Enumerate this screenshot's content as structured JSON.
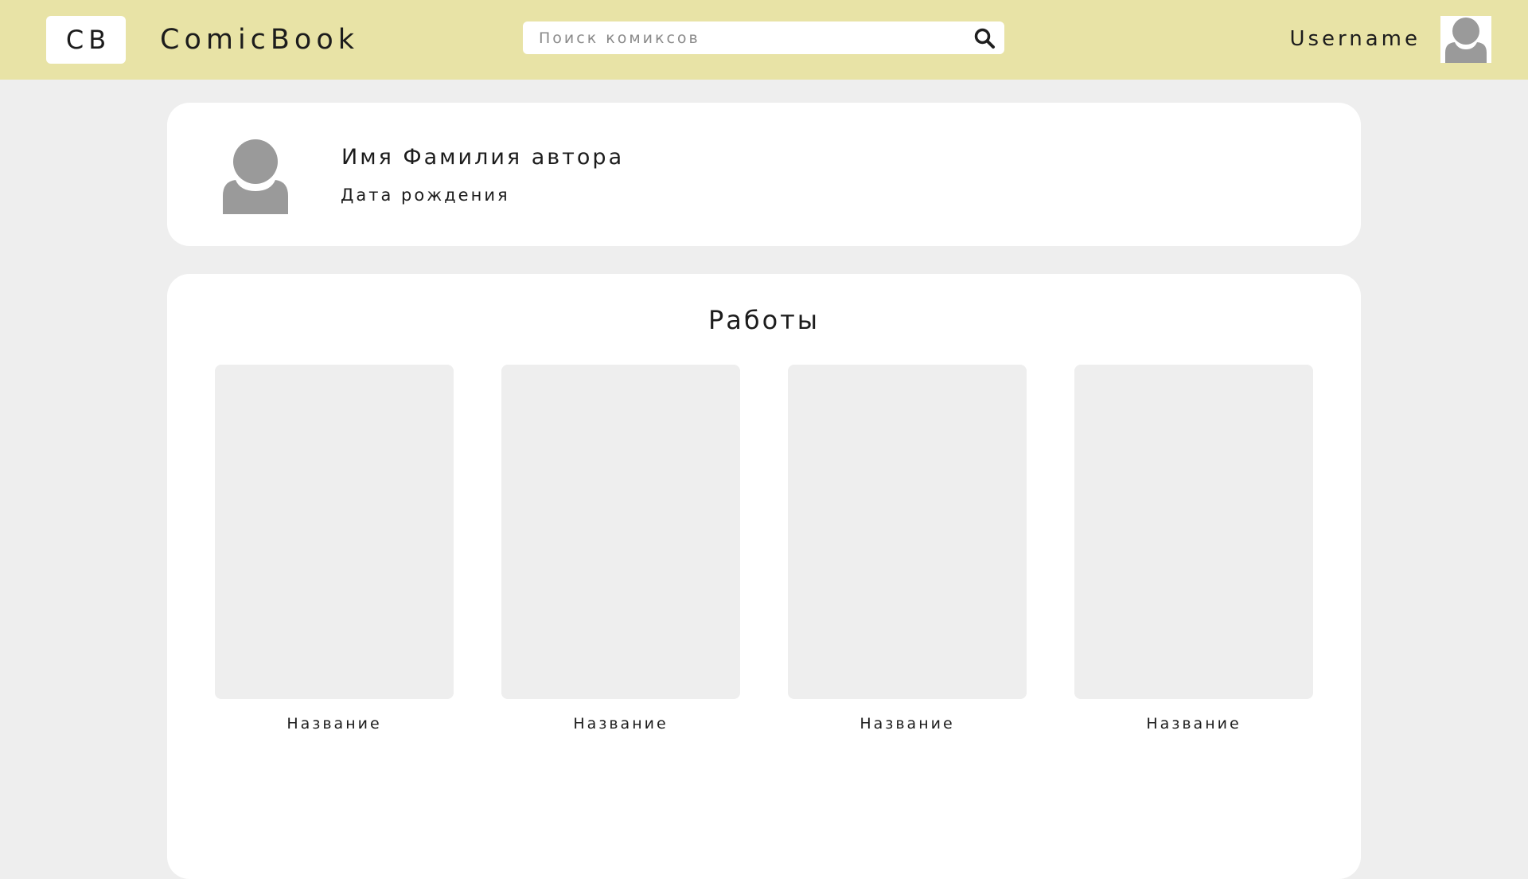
{
  "header": {
    "logo_text": "CB",
    "brand": "ComicBook",
    "search_placeholder": "Поиск комиксов",
    "username": "Username",
    "background_color": "#e8e3a6"
  },
  "author": {
    "name": "Имя Фамилия автора",
    "birth_date": "Дата рождения"
  },
  "works": {
    "title": "Работы",
    "items": [
      {
        "name": "Название"
      },
      {
        "name": "Название"
      },
      {
        "name": "Название"
      },
      {
        "name": "Название"
      }
    ]
  },
  "colors": {
    "page_background": "#eeeeee",
    "card_background": "#ffffff",
    "avatar_gray": "#9a9a9a"
  },
  "icons": {
    "search": "search-icon",
    "avatar": "user-avatar-icon"
  }
}
